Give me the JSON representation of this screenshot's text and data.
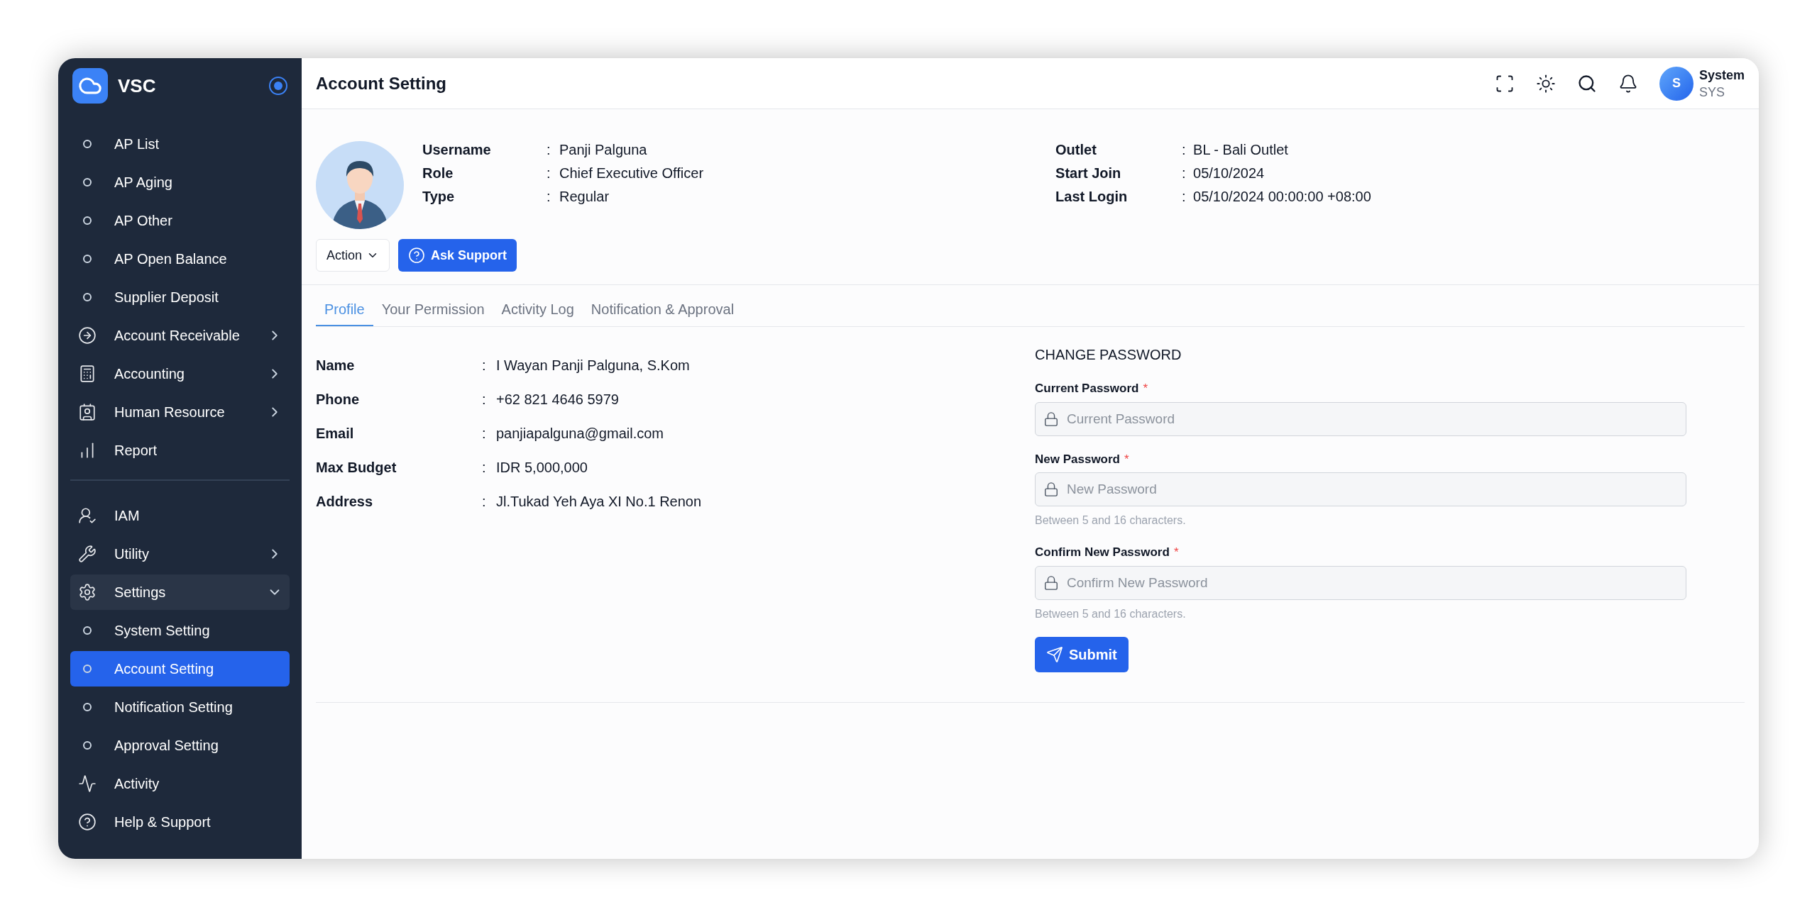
{
  "sidebar": {
    "brand": "VSC",
    "sections": [
      {
        "items": [
          {
            "label": "AP List",
            "kind": "sub",
            "selected": false
          },
          {
            "label": "AP Aging",
            "kind": "sub",
            "selected": false
          },
          {
            "label": "AP Other",
            "kind": "sub",
            "selected": false
          },
          {
            "label": "AP Open Balance",
            "kind": "sub",
            "selected": false
          },
          {
            "label": "Supplier Deposit",
            "kind": "sub",
            "selected": false
          },
          {
            "label": "Account Receivable",
            "kind": "menu",
            "selected": false,
            "expanded": false
          },
          {
            "label": "Accounting",
            "kind": "menu",
            "selected": false,
            "expanded": false
          },
          {
            "label": "Human Resource",
            "kind": "menu",
            "selected": false,
            "expanded": false
          },
          {
            "label": "Report",
            "kind": "menu",
            "selected": false
          }
        ]
      },
      {
        "items": [
          {
            "label": "IAM",
            "kind": "menu",
            "selected": false
          },
          {
            "label": "Utility",
            "kind": "menu",
            "selected": false,
            "expanded": false
          },
          {
            "label": "Settings",
            "kind": "menu",
            "selected": false,
            "expanded": true,
            "children": [
              {
                "label": "System Setting",
                "kind": "sub",
                "selected": false
              },
              {
                "label": "Account Setting",
                "kind": "sub",
                "selected": true
              },
              {
                "label": "Notification Setting",
                "kind": "sub",
                "selected": false
              },
              {
                "label": "Approval Setting",
                "kind": "sub",
                "selected": false
              }
            ]
          },
          {
            "label": "Activity",
            "kind": "menu",
            "selected": false
          },
          {
            "label": "Help & Support",
            "kind": "menu",
            "selected": false
          }
        ]
      }
    ]
  },
  "header": {
    "title": "Account Setting",
    "user": {
      "initial": "S",
      "name": "System",
      "code": "SYS"
    }
  },
  "profile": {
    "summary_left": [
      {
        "label": "Username",
        "separator": ":",
        "value": "Panji Palguna"
      },
      {
        "label": "Role",
        "separator": ":",
        "value": "Chief Executive Officer"
      },
      {
        "label": "Type",
        "separator": ":",
        "value": "Regular"
      }
    ],
    "summary_right": [
      {
        "label": "Outlet",
        "separator": ":",
        "value": "BL - Bali Outlet"
      },
      {
        "label": "Start Join",
        "separator": ":",
        "value": "05/10/2024"
      },
      {
        "label": "Last Login",
        "separator": ":",
        "value": "05/10/2024 00:00:00 +08:00"
      }
    ],
    "action_button": "Action",
    "support_button": "Ask Support"
  },
  "tabs": [
    {
      "label": "Profile",
      "selected": true
    },
    {
      "label": "Your Permission",
      "selected": false
    },
    {
      "label": "Activity Log",
      "selected": false
    },
    {
      "label": "Notification & Approval",
      "selected": false
    }
  ],
  "details": [
    {
      "label": "Name",
      "separator": ":",
      "value": "I Wayan Panji Palguna, S.Kom"
    },
    {
      "label": "Phone",
      "separator": ":",
      "value": "+62 821 4646 5979"
    },
    {
      "label": "Email",
      "separator": ":",
      "value": "panjiapalguna@gmail.com"
    },
    {
      "label": "Max Budget",
      "separator": ":",
      "value": "IDR 5,000,000"
    },
    {
      "label": "Address",
      "separator": ":",
      "value": "Jl.Tukad Yeh Aya XI No.1 Renon"
    }
  ],
  "change_password": {
    "title": "CHANGE PASSWORD",
    "fields": [
      {
        "label": "Current Password",
        "required_mark": "*",
        "placeholder": "Current Password"
      },
      {
        "label": "New Password",
        "required_mark": "*",
        "placeholder": "New Password",
        "hint": "Between 5 and 16 characters."
      },
      {
        "label": "Confirm New Password",
        "required_mark": "*",
        "placeholder": "Confirm New Password",
        "hint": "Between 5 and 16 characters."
      }
    ],
    "submit": "Submit"
  }
}
